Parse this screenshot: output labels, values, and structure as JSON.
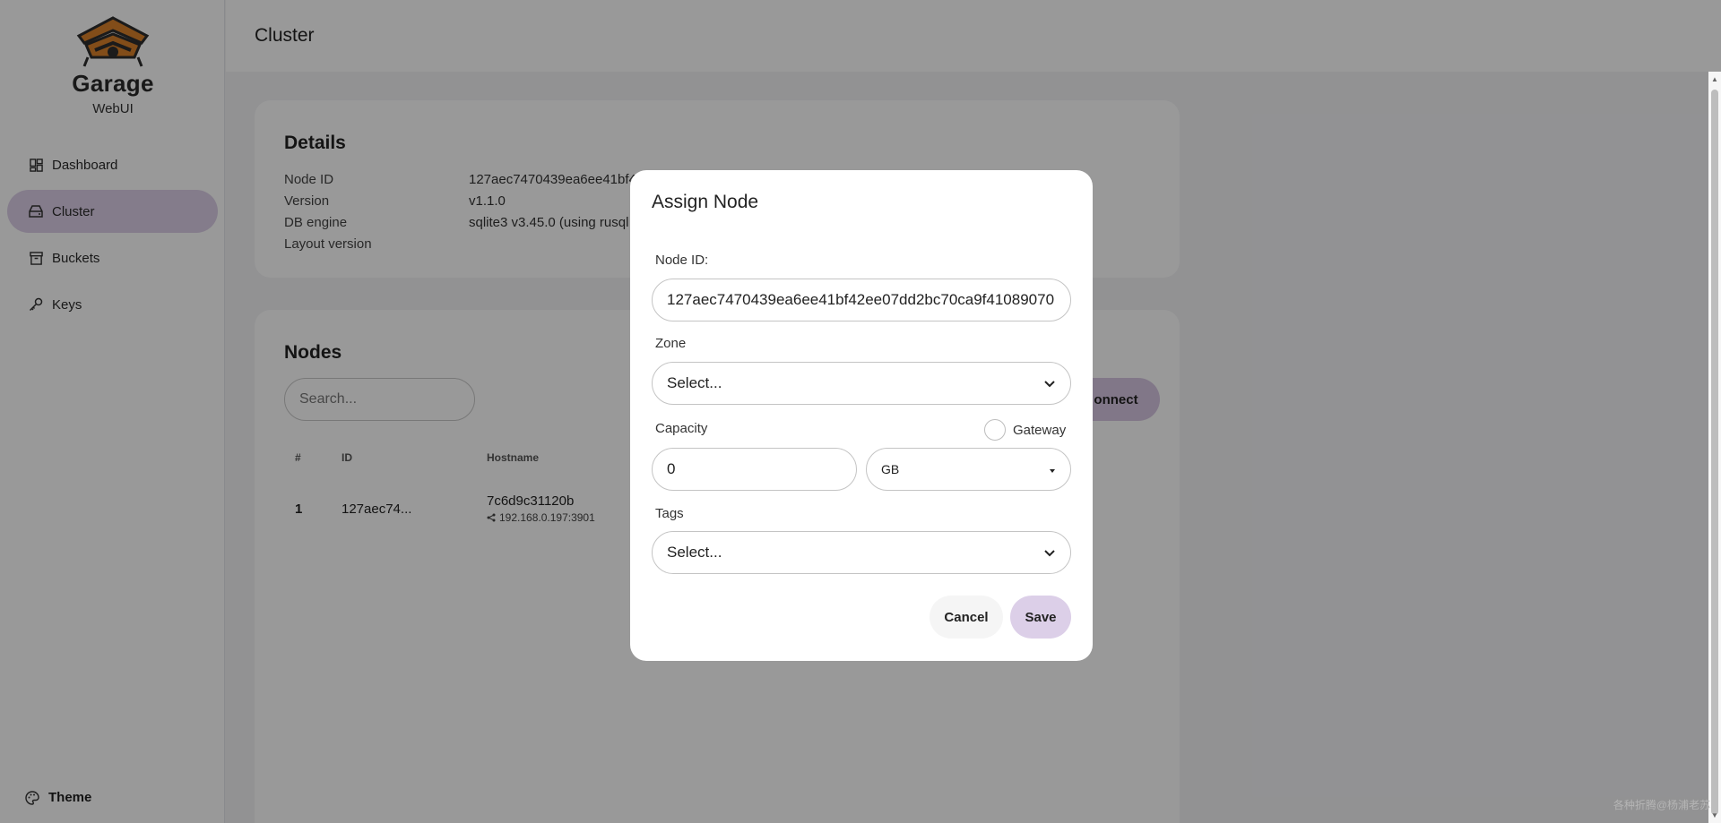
{
  "app": {
    "logo_title": "Garage",
    "logo_subtitle": "WebUI",
    "brand_color": "#d9812a",
    "accent_color": "#dccfe8"
  },
  "sidebar": {
    "items": [
      {
        "label": "Dashboard",
        "icon": "dashboard-icon",
        "active": false
      },
      {
        "label": "Cluster",
        "icon": "cluster-icon",
        "active": true
      },
      {
        "label": "Buckets",
        "icon": "bucket-icon",
        "active": false
      },
      {
        "label": "Keys",
        "icon": "key-icon",
        "active": false
      }
    ],
    "theme_label": "Theme"
  },
  "header": {
    "title": "Cluster"
  },
  "details": {
    "title": "Details",
    "rows": [
      {
        "key": "Node ID",
        "value": "127aec7470439ea6ee41bf4"
      },
      {
        "key": "Version",
        "value": "v1.1.0"
      },
      {
        "key": "DB engine",
        "value": "sqlite3 v3.45.0 (using rusql"
      },
      {
        "key": "Layout version",
        "value": ""
      }
    ]
  },
  "nodes": {
    "title": "Nodes",
    "search_placeholder": "Search...",
    "connect_label": "onnect",
    "columns": [
      "#",
      "ID",
      "Hostname"
    ],
    "rows": [
      {
        "index": "1",
        "id": "127aec74...",
        "hostname": "7c6d9c31120b",
        "address": "192.168.0.197:3901"
      }
    ]
  },
  "modal": {
    "title": "Assign Node",
    "node_id_label": "Node ID:",
    "node_id_value": "127aec7470439ea6ee41bf42ee07dd2bc70ca9f41089070",
    "zone_label": "Zone",
    "zone_value": "Select...",
    "capacity_label": "Capacity",
    "capacity_value": "0",
    "unit_value": "GB",
    "gateway_label": "Gateway",
    "gateway_checked": false,
    "tags_label": "Tags",
    "tags_value": "Select...",
    "cancel_label": "Cancel",
    "save_label": "Save"
  },
  "watermark": "各种折腾@杨浦老苏"
}
